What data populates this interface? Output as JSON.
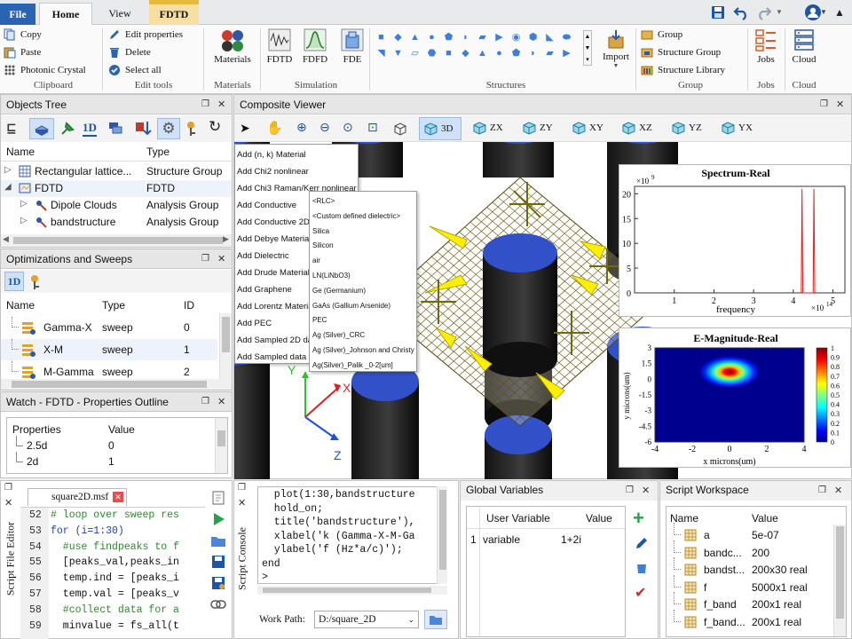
{
  "tabs": {
    "file": "File",
    "home": "Home",
    "view": "View",
    "fdtd": "FDTD"
  },
  "clipboard": {
    "copy": "Copy",
    "paste": "Paste",
    "photonic": "Photonic Crystal",
    "label": "Clipboard"
  },
  "edit": {
    "props": "Edit properties",
    "delete": "Delete",
    "select_all": "Select all",
    "label": "Edit tools"
  },
  "materials": {
    "btn": "Materials",
    "label": "Materials"
  },
  "simulation": {
    "fdtd": "FDTD",
    "fdfd": "FDFD",
    "fde": "FDE",
    "label": "Simulation"
  },
  "structures": {
    "label": "Structures",
    "import": "Import"
  },
  "group": {
    "group": "Group",
    "structure_group": "Structure Group",
    "structure_library": "Structure Library",
    "label": "Group"
  },
  "jobs": {
    "btn": "Jobs",
    "label": "Jobs"
  },
  "cloud": {
    "btn": "Cloud",
    "label": "Cloud"
  },
  "objects_tree": {
    "title": "Objects Tree",
    "col_name": "Name",
    "col_type": "Type",
    "rows": [
      {
        "name": "Rectangular lattice...",
        "type": "Structure Group"
      },
      {
        "name": "FDTD",
        "type": "FDTD"
      },
      {
        "name": "Dipole Clouds",
        "type": "Analysis Group"
      },
      {
        "name": "bandstructure",
        "type": "Analysis Group"
      }
    ]
  },
  "optimizations": {
    "title": "Optimizations and Sweeps",
    "col_name": "Name",
    "col_type": "Type",
    "col_id": "ID",
    "rows": [
      {
        "name": "Gamma-X",
        "type": "sweep",
        "id": "0"
      },
      {
        "name": "X-M",
        "type": "sweep",
        "id": "1"
      },
      {
        "name": "M-Gamma",
        "type": "sweep",
        "id": "2"
      }
    ]
  },
  "watch": {
    "title": "Watch - FDTD - Properties Outline",
    "col_props": "Properties",
    "col_value": "Value",
    "rows": [
      {
        "name": "2.5d",
        "value": "0"
      },
      {
        "name": "2d",
        "value": "1"
      }
    ]
  },
  "viewer": {
    "title": "Composite Viewer",
    "views": [
      "3D",
      "ZX",
      "ZY",
      "XY",
      "XZ",
      "YZ",
      "YX"
    ]
  },
  "context_menu": [
    "Add (n, k) Material",
    "Add Chi2 nonlinear",
    "Add Chi3 Raman/Kerr nonlinear",
    "Add Conductive",
    "Add Conductive 2D",
    "Add Debye Material",
    "Add Dielectric",
    "Add Drude Material",
    "Add Graphene",
    "Add Lorentz Material",
    "Add PEC",
    "Add Sampled 2D data",
    "Add Sampled data"
  ],
  "submenu": [
    "<RLC>",
    "<Custom defined dielectric>",
    "Silica",
    "Silicon",
    "air",
    "LN(LiNbO3)",
    "Ge (Germanium)",
    "GaAs (Gallium Arsenide)",
    "PEC",
    "Ag (Silver)_CRC",
    "Ag (Silver)_Johnson and Christy",
    "Ag(Silver)_Palik _0-2[um]"
  ],
  "axes3d": {
    "x": "X",
    "y": "Y",
    "z": "Z"
  },
  "spectrum": {
    "title": "Spectrum-Real",
    "xlabel": "frequency",
    "exp_y": "×10",
    "exp_y_pow": "9",
    "exp_x": "×10",
    "exp_x_pow": "14",
    "yticks": [
      "20",
      "15",
      "10",
      "5",
      "0"
    ],
    "xticks": [
      "1",
      "2",
      "3",
      "4",
      "5"
    ]
  },
  "emag": {
    "title": "E-Magnitude-Real",
    "xlabel": "x microns(um)",
    "ylabel": "y microns(um)",
    "xticks": [
      "-4",
      "-2",
      "0",
      "2",
      "4"
    ],
    "yticks": [
      "3",
      "1.5",
      "0",
      "-1.5",
      "-3",
      "-4.5",
      "-6"
    ],
    "cbar": [
      "1",
      "0.9",
      "0.8",
      "0.7",
      "0.6",
      "0.5",
      "0.4",
      "0.3",
      "0.2",
      "0.1",
      "0"
    ]
  },
  "chart_data": [
    {
      "type": "line",
      "title": "Spectrum-Real",
      "xlabel": "frequency",
      "xlim": [
        0,
        5.3
      ],
      "ylim": [
        0,
        21.5
      ],
      "series": [
        {
          "x": [
            4.2,
            4.22,
            4.24,
            4.5,
            4.52,
            4.54
          ],
          "y": [
            0,
            21,
            0,
            0,
            21,
            0
          ]
        }
      ]
    },
    {
      "type": "heatmap",
      "title": "E-Magnitude-Real",
      "xlabel": "x microns(um)",
      "ylabel": "y microns(um)",
      "xlim": [
        -4,
        4
      ],
      "ylim": [
        -6,
        3
      ],
      "peak": {
        "x": 0,
        "y": 0.7
      }
    }
  ],
  "script_editor": {
    "side_label": "Script File Editor",
    "file_tab": "square2D.msf",
    "lines": [
      {
        "n": "52",
        "t": "# loop over sweep res",
        "c": "comment"
      },
      {
        "n": "53",
        "t": "for (i=1:30)",
        "c": "kw"
      },
      {
        "n": "54",
        "t": "  #use findpeaks to f",
        "c": "comment"
      },
      {
        "n": "55",
        "t": "  [peaks_val,peaks_in",
        "c": "code"
      },
      {
        "n": "56",
        "t": "  temp.ind = [peaks_i",
        "c": "code"
      },
      {
        "n": "57",
        "t": "  temp.val = [peaks_v",
        "c": "code"
      },
      {
        "n": "58",
        "t": "  #collect data for a",
        "c": "comment"
      },
      {
        "n": "59",
        "t": "  minvalue = fs_all(t",
        "c": "code"
      }
    ]
  },
  "script_console": {
    "side_label": "Script Console",
    "lines": [
      "  plot(1:30,bandstructure",
      "  hold_on;",
      "  title('bandstructure'),",
      "  xlabel('k (Gamma-X-M-Ga",
      "  ylabel('f (Hz*a/c)');",
      "end",
      ">"
    ],
    "work_path_label": "Work Path:",
    "work_path": "D:/square_2D"
  },
  "global_vars": {
    "title": "Global Variables",
    "col_var": "User Variable",
    "col_value": "Value",
    "rows": [
      {
        "idx": "1",
        "name": "variable",
        "value": "1+2i"
      }
    ]
  },
  "workspace": {
    "title": "Script Workspace",
    "col_name": "Name",
    "col_value": "Value",
    "rows": [
      {
        "name": "a",
        "value": "5e-07"
      },
      {
        "name": "bandc...",
        "value": "200"
      },
      {
        "name": "bandst...",
        "value": "200x30 real"
      },
      {
        "name": "f",
        "value": "5000x1 real"
      },
      {
        "name": "f_band",
        "value": "200x1 real"
      },
      {
        "name": "f_band...",
        "value": "200x1 real"
      }
    ]
  }
}
